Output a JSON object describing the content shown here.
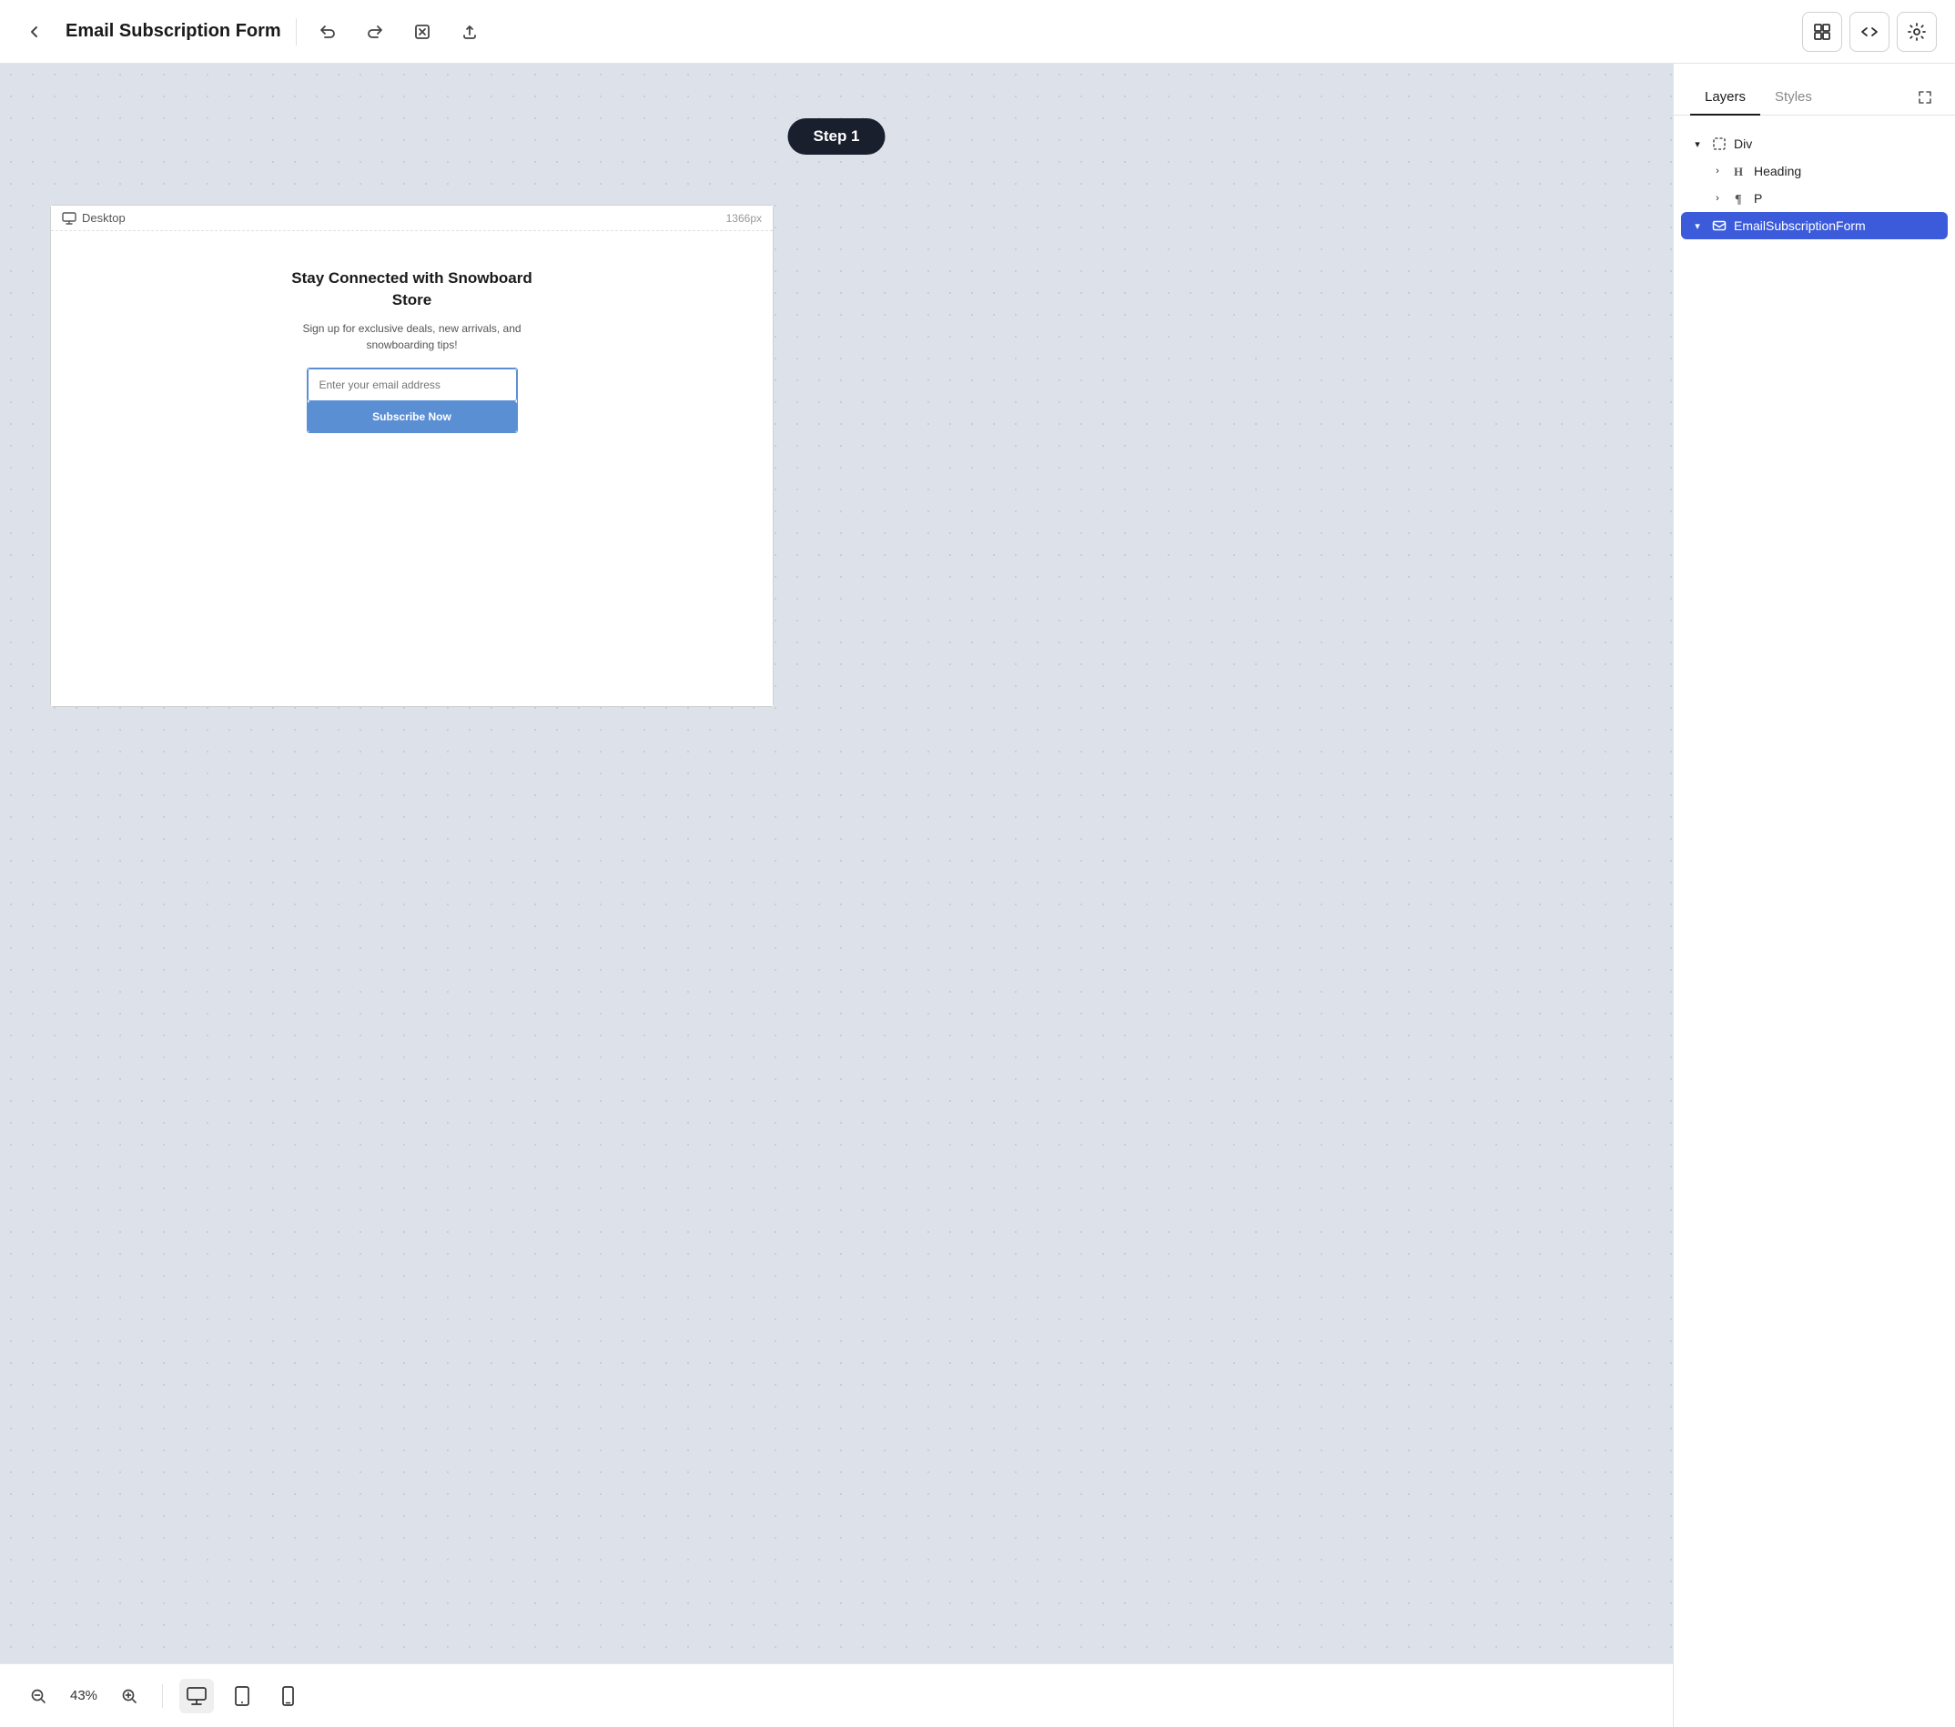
{
  "topbar": {
    "back_label": "←",
    "title": "Email Subscription Form",
    "undo_label": "↩",
    "redo_label": "↪",
    "close_label": "✕",
    "upload_label": "⬆",
    "grid_icon": "⊞",
    "code_icon": "</>",
    "settings_icon": "⚙"
  },
  "canvas": {
    "step_badge": "Step 1",
    "desktop_label": "Desktop",
    "desktop_px": "1366px",
    "form": {
      "heading_line1": "Stay Connected with Snowboard",
      "heading_line2": "Store",
      "subtext": "Sign up for exclusive deals, new arrivals, and",
      "subtext2": "snowboarding tips!",
      "input_placeholder": "Enter your email address",
      "button_label": "Subscribe Now"
    }
  },
  "bottom_bar": {
    "zoom_out": "−",
    "zoom_level": "43%",
    "zoom_in": "+",
    "device_desktop": "🖥",
    "device_tablet": "📱",
    "device_mobile": "📱"
  },
  "right_panel": {
    "tab_layers": "Layers",
    "tab_styles": "Styles",
    "expand_icon": "⤢",
    "layers": [
      {
        "id": "div",
        "indent": 0,
        "icon": "◻",
        "label": "Div",
        "expanded": true,
        "selected": false
      },
      {
        "id": "heading",
        "indent": 1,
        "icon": "H",
        "label": "Heading",
        "expanded": false,
        "selected": false
      },
      {
        "id": "p",
        "indent": 1,
        "icon": "¶",
        "label": "P",
        "expanded": false,
        "selected": false
      },
      {
        "id": "email-form",
        "indent": 0,
        "icon": "✉",
        "label": "EmailSubscriptionForm",
        "expanded": true,
        "selected": true
      }
    ]
  }
}
